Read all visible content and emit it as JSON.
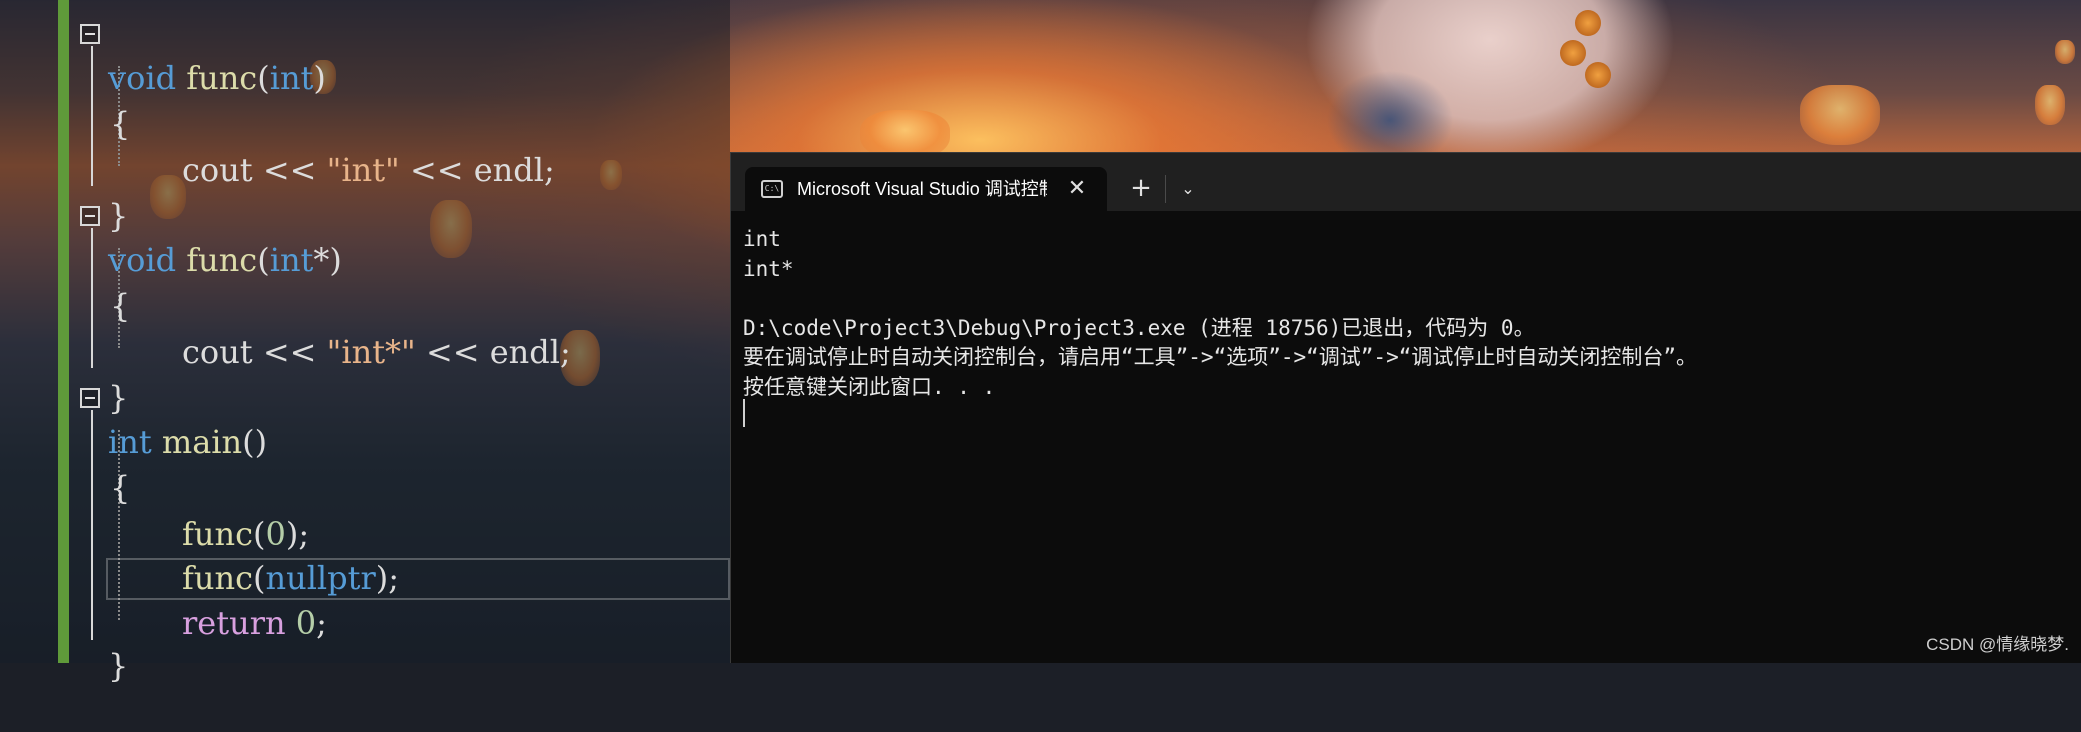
{
  "editor": {
    "lines": {
      "l1": {
        "kw": "void",
        "fn": "func",
        "p1": "(",
        "type": "int",
        "p2": ")"
      },
      "l2": {
        "brace": "{"
      },
      "l3": {
        "a": "cout << ",
        "str": "\"int\"",
        "b": " << endl;"
      },
      "l4": {
        "brace": "}"
      },
      "l5": {
        "kw": "void",
        "fn": "func",
        "p1": "(",
        "type": "int",
        "p2": "*)"
      },
      "l6": {
        "brace": "{"
      },
      "l7": {
        "a": "cout << ",
        "str": "\"int*\"",
        "b": " << endl;"
      },
      "l8": {
        "brace": "}"
      },
      "l9": {
        "kw": "int",
        "fn": "main",
        "p": "()"
      },
      "l10": {
        "brace": "{"
      },
      "l11": {
        "fn": "func",
        "p1": "(",
        "num": "0",
        "p2": ");"
      },
      "l12": {
        "fn": "func",
        "p1": "(",
        "lit": "nullptr",
        "p2": ");"
      },
      "l13": {
        "ret": "return",
        "num": "0",
        "semi": ";"
      },
      "l14": {
        "brace": "}"
      }
    }
  },
  "terminal": {
    "tab_icon": "C:\\",
    "tab_title": "Microsoft Visual Studio 调试控制台",
    "tab_close": "✕",
    "new_tab": "+",
    "dropdown": "⌄",
    "output": [
      "int",
      "int*",
      "",
      "D:\\code\\Project3\\Debug\\Project3.exe (进程 18756)已退出，代码为 0。",
      "要在调试停止时自动关闭控制台，请启用“工具”->“选项”->“调试”->“调试停止时自动关闭控制台”。",
      "按任意键关闭此窗口. . ."
    ]
  },
  "watermark": "CSDN @情缘晓梦."
}
